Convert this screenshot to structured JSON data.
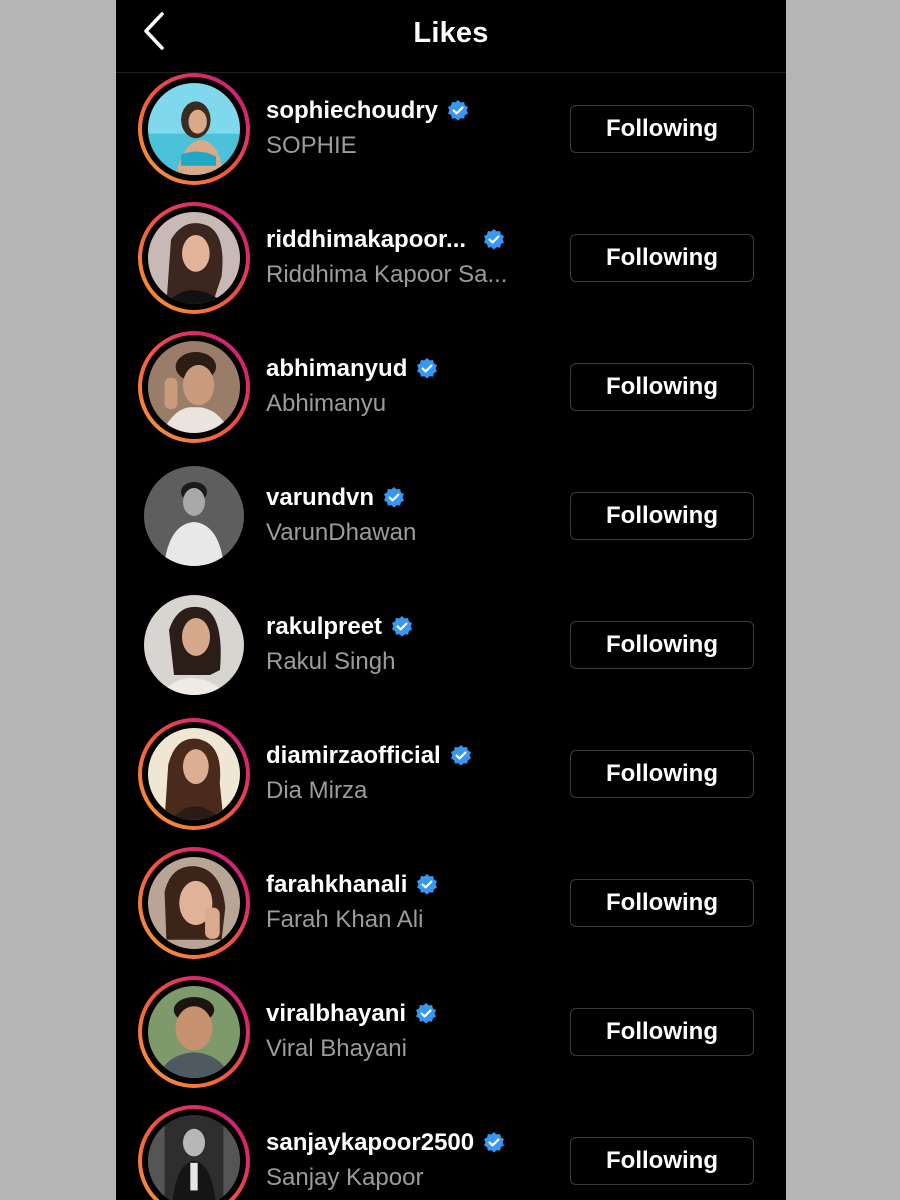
{
  "header": {
    "title": "Likes",
    "back_icon": "chevron-left-icon"
  },
  "colors": {
    "verified_badge": "#3897f0",
    "story_ring_start": "#f9a23a",
    "story_ring_end": "#c1237f"
  },
  "users": [
    {
      "username": "sophiechoudry",
      "full_name": "SOPHIE",
      "verified": true,
      "story_ring": true,
      "button": "Following"
    },
    {
      "username": "riddhimakapoor...",
      "full_name": "Riddhima Kapoor Sa...",
      "verified": true,
      "story_ring": true,
      "button": "Following"
    },
    {
      "username": "abhimanyud",
      "full_name": "Abhimanyu",
      "verified": true,
      "story_ring": true,
      "button": "Following"
    },
    {
      "username": "varundvn",
      "full_name": "VarunDhawan",
      "verified": true,
      "story_ring": false,
      "button": "Following"
    },
    {
      "username": "rakulpreet",
      "full_name": "Rakul Singh",
      "verified": true,
      "story_ring": false,
      "button": "Following"
    },
    {
      "username": "diamirzaofficial",
      "full_name": "Dia Mirza",
      "verified": true,
      "story_ring": true,
      "button": "Following"
    },
    {
      "username": "farahkhanali",
      "full_name": "Farah Khan Ali",
      "verified": true,
      "story_ring": true,
      "button": "Following"
    },
    {
      "username": "viralbhayani",
      "full_name": "Viral Bhayani",
      "verified": true,
      "story_ring": true,
      "button": "Following"
    },
    {
      "username": "sanjaykapoor2500",
      "full_name": "Sanjay Kapoor",
      "verified": true,
      "story_ring": true,
      "button": "Following"
    }
  ]
}
